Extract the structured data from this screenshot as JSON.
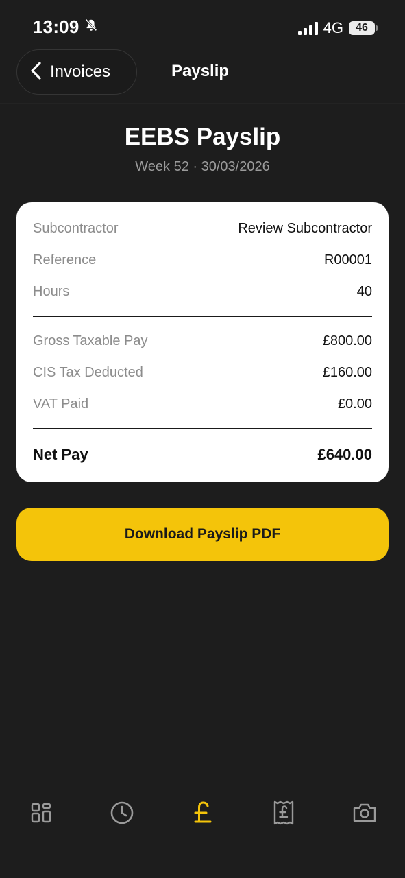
{
  "status_bar": {
    "time": "13:09",
    "network": "4G",
    "battery": "46"
  },
  "header": {
    "back_label": "Invoices",
    "title": "Payslip"
  },
  "payslip": {
    "title": "EEBS Payslip",
    "subtitle": "Week 52 · 30/03/2026",
    "rows": [
      {
        "label": "Subcontractor",
        "value": "Review Subcontractor"
      },
      {
        "label": "Reference",
        "value": "R00001"
      },
      {
        "label": "Hours",
        "value": "40"
      },
      {
        "label": "Gross Taxable Pay",
        "value": "£800.00"
      },
      {
        "label": "CIS Tax Deducted",
        "value": "£160.00"
      },
      {
        "label": "VAT Paid",
        "value": "£0.00"
      }
    ],
    "net": {
      "label": "Net Pay",
      "value": "£640.00"
    }
  },
  "actions": {
    "download_label": "Download Payslip PDF"
  },
  "tab_bar": {
    "tabs": [
      {
        "icon": "dashboard-grid-icon",
        "active": false
      },
      {
        "icon": "clock-icon",
        "active": false
      },
      {
        "icon": "pound-icon",
        "active": true
      },
      {
        "icon": "receipt-icon",
        "active": false
      },
      {
        "icon": "camera-icon",
        "active": false
      }
    ],
    "active_color": "#f4c40a",
    "inactive_color": "#9a9a9a"
  },
  "colors": {
    "background": "#1d1d1d",
    "accent": "#f4c40a",
    "card": "#ffffff"
  }
}
